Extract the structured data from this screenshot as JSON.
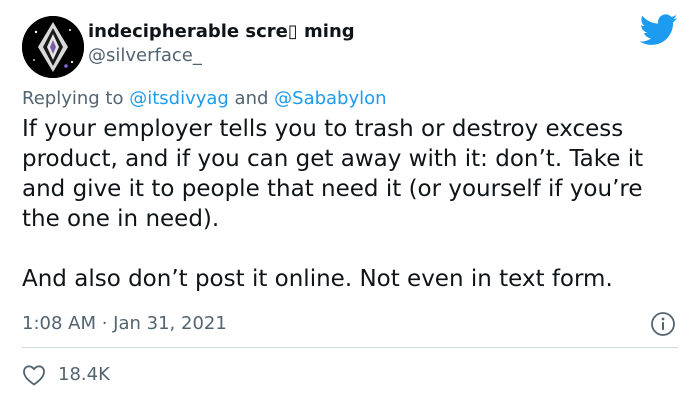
{
  "author": {
    "display_name": "indecipherable scre▯ ming",
    "handle": "@silverface_",
    "avatar_icon": "diamond-crystal-avatar"
  },
  "brand_icon": "twitter-bird-icon",
  "reply": {
    "prefix": "Replying to ",
    "mention1": "@itsdivyag",
    "connector": " and ",
    "mention2": "@Sababylon"
  },
  "tweet": {
    "paragraph1": "If your employer tells you to trash or destroy excess product, and if you can get away with it: don’t. Take it and give it to people that need it (or yourself if you’re the one in need).",
    "paragraph2": "And also don’t post it online. Not even in text form."
  },
  "meta": {
    "time": "1:08 AM",
    "separator": " · ",
    "date": "Jan 31, 2021"
  },
  "likes": {
    "count": "18.4K",
    "icon": "heart-icon"
  },
  "colors": {
    "text": "#0f1419",
    "secondary": "#536471",
    "link": "#1d9bf0",
    "divider": "#cfd9de"
  }
}
